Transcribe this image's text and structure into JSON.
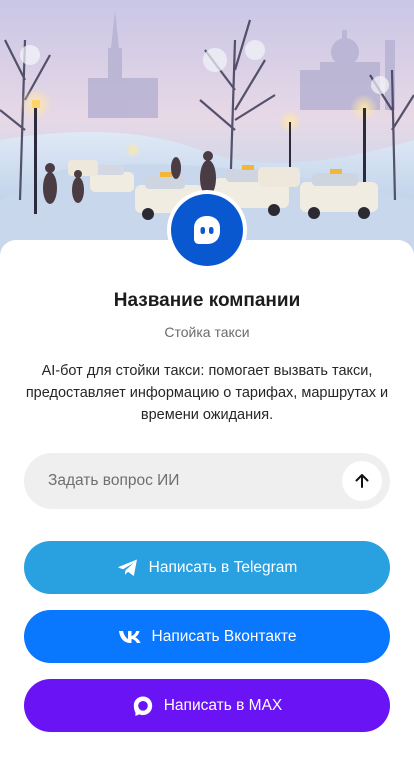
{
  "company": {
    "name": "Название компании",
    "category": "Стойка такси",
    "description": "AI-бот для стойки такси: помогает вызвать такси, предоставляет информацию о тарифах, маршрутах и времени ожидания."
  },
  "ask": {
    "placeholder": "Задать вопрос ИИ"
  },
  "buttons": {
    "telegram": "Написать в Telegram",
    "vk": "Написать Вконтакте",
    "max": "Написать в MAX"
  },
  "icons": {
    "avatar": "chat-bot-icon",
    "send": "arrow-up-icon",
    "telegram": "telegram-icon",
    "vk": "vk-icon",
    "max": "max-icon"
  },
  "colors": {
    "avatar": "#0a58d0",
    "telegram": "#29a0df",
    "vk": "#0a77ff",
    "max": "#6a14f5",
    "input_bg": "#efefef"
  }
}
